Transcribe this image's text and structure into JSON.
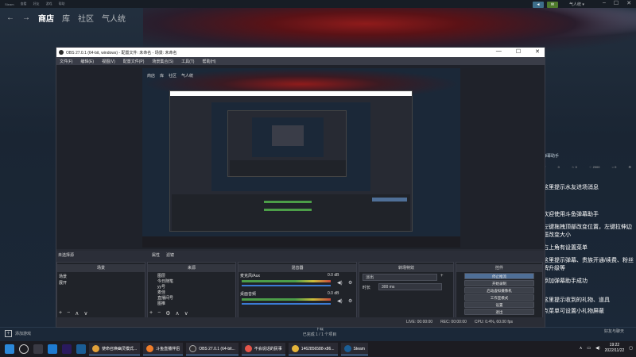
{
  "steam": {
    "top_menu": [
      "Steam",
      "查看",
      "好友",
      "游戏",
      "帮助"
    ],
    "nav": {
      "back": "←",
      "forward": "→",
      "store": "商店",
      "library": "库",
      "community": "社区",
      "user": "气人统"
    },
    "user_name": "气人统 ▾",
    "chat": {
      "header": "弹幕助手",
      "stats": [
        "♡",
        "0",
        "☆ 0",
        "♢ 2000",
        "○ 0",
        "⚙"
      ],
      "messages": [
        "这里提示水友进场消息",
        "欢迎使用斗鱼弹幕助手",
        "左键拖拽顶部改变位置，左键拉伸边框改变大小",
        "右上角有设置菜单",
        "这里提示弹幕、贵族开通/续费、粉丝牌升级等",
        "添加弹幕助手成功",
        "这里提示收到的礼物、道具",
        "点菜单可设置小礼物屏蔽"
      ]
    },
    "bottom": {
      "add_game": "添加游戏",
      "downloads": "下载",
      "downloads_sub": "已完成 1 / 1 个项目",
      "friends": "好友与聊天"
    }
  },
  "obs": {
    "title": "OBS 27.0.1 (64-bit, windows) - 配置文件: 未命名 - 场景: 未命名",
    "window_buttons": [
      "—",
      "☐",
      "✕"
    ],
    "menu": [
      "文件(F)",
      "编辑(E)",
      "视图(V)",
      "配置文件(P)",
      "场景集合(S)",
      "工具(T)",
      "帮助(H)"
    ],
    "preview_nav": [
      "商店",
      "库",
      "社区",
      "气人统"
    ],
    "source_toolbar": {
      "label": "未选择源",
      "properties": "属性",
      "filters": "滤镜"
    },
    "docks": {
      "scenes": {
        "title": "场景",
        "items": [
          "场景",
          "展开"
        ]
      },
      "sources": {
        "title": "来源",
        "items": [
          "图层",
          "今日随笔",
          "yy号",
          "麦佳",
          "直播间号",
          "图推"
        ]
      },
      "mixer": {
        "title": "混音器",
        "channels": [
          {
            "name": "麦克风/Aux",
            "db": "0.0 dB"
          },
          {
            "name": "桌面音频",
            "db": "0.0 dB"
          }
        ]
      },
      "transitions": {
        "title": "转场特效",
        "type": "淡出",
        "duration_label": "时长",
        "duration": "300 ms"
      },
      "controls": {
        "title": "控件",
        "buttons": [
          "停止推流",
          "开始录制",
          "启动虚拟摄像机",
          "工作室模式",
          "设置",
          "退出"
        ]
      }
    },
    "status": {
      "live": "LIVE: 00:00:00",
      "rec": "REC: 00:00:00",
      "cpu": "CPU: 0.4%, 60.00 fps"
    }
  },
  "taskbar": {
    "apps": [
      {
        "label": "使命召唤幽灵模式...",
        "color": "#e1a13a"
      },
      {
        "label": "斗鱼直播伴侣",
        "color": "#f07d2a"
      },
      {
        "label": "OBS 27.0.1 (64-bit...",
        "color": "#302e31"
      },
      {
        "label": "不会说话的民事",
        "color": "#e4554a"
      },
      {
        "label": "1462856588-x86...",
        "color": "#e4b43a"
      },
      {
        "label": "Steam",
        "color": "#1b5e96"
      }
    ],
    "time": "19:22",
    "date": "2022/11/22"
  },
  "colors": {
    "steam_bg": "#1b2838",
    "obs_bg": "#272a33",
    "accent": "#4f6f97"
  }
}
